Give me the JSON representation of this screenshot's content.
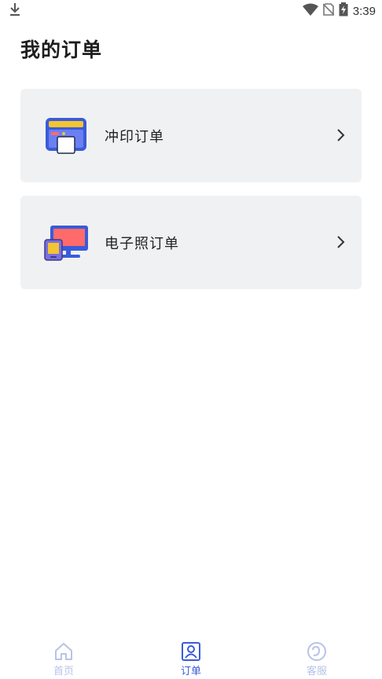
{
  "status_bar": {
    "time": "3:39",
    "icons": [
      "download-icon",
      "wifi-icon",
      "no-sim-icon",
      "battery-charging-icon"
    ]
  },
  "page": {
    "title": "我的订单"
  },
  "cards": [
    {
      "label": "冲印订单",
      "icon": "print-order-icon"
    },
    {
      "label": "电子照订单",
      "icon": "digital-photo-order-icon"
    }
  ],
  "tabbar": {
    "home": "首页",
    "orders": "订单",
    "service": "客服"
  },
  "colors": {
    "accent": "#3a5bd9",
    "inactive_tab": "#b7c3e8",
    "card_bg": "#f0f1f3"
  }
}
